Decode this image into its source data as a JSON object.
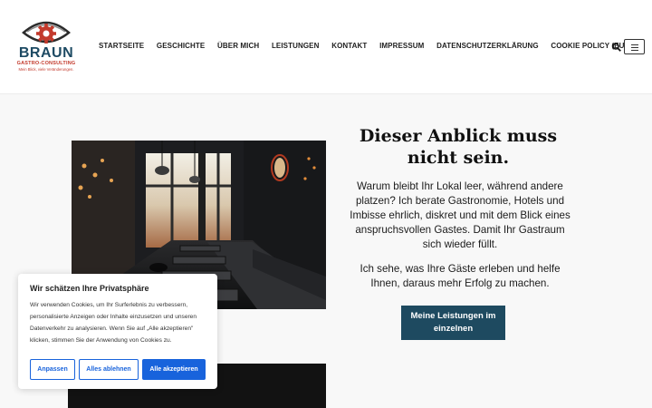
{
  "logo": {
    "word": "BRAUN",
    "sub": "GASTRO-CONSULTING",
    "tagline": "Mein Blick, viele Veränderungen."
  },
  "nav": {
    "items": [
      "STARTSEITE",
      "GESCHICHTE",
      "ÜBER MICH",
      "LEISTUNGEN",
      "KONTAKT",
      "IMPRESSUM",
      "DATENSCHUTZERKLÄRUNG",
      "COOKIE POLICY (EU)"
    ]
  },
  "hero": {
    "headline": "Dieser Anblick muss nicht sein.",
    "paragraph1": "Warum bleibt Ihr Lokal leer, während andere platzen? Ich berate Gastronomie, Hotels und Imbisse ehrlich, diskret und mit dem Blick eines anspruchsvollen Gastes. Damit Ihr Gastraum sich wieder füllt.",
    "paragraph2": "Ich sehe, was Ihre Gäste erleben und helfe Ihnen, daraus mehr Erfolg zu machen.",
    "cta": "Meine Leistungen im einzelnen"
  },
  "cookie": {
    "title": "Wir schätzen Ihre Privatsphäre",
    "text": "Wir verwenden Cookies, um Ihr Surferlebnis zu verbessern, personalisierte Anzeigen oder Inhalte einzusetzen und unseren Datenverkehr zu analysieren. Wenn Sie auf „Alle akzeptieren\" klicken, stimmen Sie der Anwendung von Cookies zu.",
    "customize": "Anpassen",
    "reject": "Alles ablehnen",
    "accept": "Alle akzeptieren"
  },
  "colors": {
    "brand_blue": "#1e4a60",
    "brand_red": "#c33a2c",
    "cookie_blue": "#1863dc"
  },
  "icons": [
    "logo-eye-gear-icon",
    "search-icon",
    "hamburger-menu-icon"
  ]
}
